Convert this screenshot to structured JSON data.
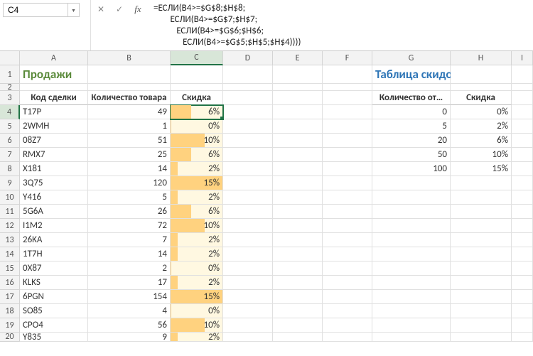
{
  "formula_bar": {
    "name_box": "C4",
    "cancel": "✕",
    "confirm": "✓",
    "fx": "fx",
    "formula": "=ЕСЛИ(B4>=$G$8;$H$8;\n        ЕСЛИ(B4>=$G$7;$H$7;\n           ЕСЛИ(B4>=$G$6;$H$6;\n              ЕСЛИ(B4>=$G$5;$H$5;$H$4))))"
  },
  "columns": [
    "A",
    "B",
    "C",
    "D",
    "E",
    "F",
    "G",
    "H",
    "I"
  ],
  "titles": {
    "sales": "Продажи",
    "discounts": "Таблица скидок"
  },
  "headers": {
    "deal": "Код сделки",
    "qty": "Количество товара",
    "disc": "Скидка",
    "qty_from": "Количество от…",
    "disc2": "Скидка"
  },
  "sales": [
    {
      "code": "T17P",
      "qty": "49",
      "disc": "6%",
      "bar": 40
    },
    {
      "code": "2WMH",
      "qty": "1",
      "disc": "0%",
      "bar": 2
    },
    {
      "code": "08Z7",
      "qty": "51",
      "disc": "10%",
      "bar": 66
    },
    {
      "code": "RMX7",
      "qty": "25",
      "disc": "6%",
      "bar": 40
    },
    {
      "code": "X181",
      "qty": "14",
      "disc": "2%",
      "bar": 14
    },
    {
      "code": "3Q75",
      "qty": "120",
      "disc": "15%",
      "bar": 100
    },
    {
      "code": "Y416",
      "qty": "5",
      "disc": "2%",
      "bar": 14
    },
    {
      "code": "5G6A",
      "qty": "26",
      "disc": "6%",
      "bar": 40
    },
    {
      "code": "I1M2",
      "qty": "72",
      "disc": "10%",
      "bar": 66
    },
    {
      "code": "26KA",
      "qty": "7",
      "disc": "2%",
      "bar": 14
    },
    {
      "code": "1T7H",
      "qty": "14",
      "disc": "2%",
      "bar": 14
    },
    {
      "code": "0X87",
      "qty": "2",
      "disc": "0%",
      "bar": 2
    },
    {
      "code": "KLKS",
      "qty": "17",
      "disc": "2%",
      "bar": 14
    },
    {
      "code": "6PGN",
      "qty": "154",
      "disc": "15%",
      "bar": 100
    },
    {
      "code": "SO85",
      "qty": "4",
      "disc": "0%",
      "bar": 2
    },
    {
      "code": "CPO4",
      "qty": "56",
      "disc": "10%",
      "bar": 66
    },
    {
      "code": "Y835",
      "qty": "9",
      "disc": "2%",
      "bar": 14
    }
  ],
  "discount_table": [
    {
      "from": "0",
      "disc": "0%"
    },
    {
      "from": "5",
      "disc": "2%"
    },
    {
      "from": "20",
      "disc": "6%"
    },
    {
      "from": "50",
      "disc": "10%"
    },
    {
      "from": "100",
      "disc": "15%"
    }
  ],
  "chart_data": {
    "type": "table",
    "title": "Продажи / Таблица скидок",
    "sales_columns": [
      "Код сделки",
      "Количество товара",
      "Скидка"
    ],
    "sales_rows": [
      [
        "T17P",
        49,
        "6%"
      ],
      [
        "2WMH",
        1,
        "0%"
      ],
      [
        "08Z7",
        51,
        "10%"
      ],
      [
        "RMX7",
        25,
        "6%"
      ],
      [
        "X181",
        14,
        "2%"
      ],
      [
        "3Q75",
        120,
        "15%"
      ],
      [
        "Y416",
        5,
        "2%"
      ],
      [
        "5G6A",
        26,
        "6%"
      ],
      [
        "I1M2",
        72,
        "10%"
      ],
      [
        "26KA",
        7,
        "2%"
      ],
      [
        "1T7H",
        14,
        "2%"
      ],
      [
        "0X87",
        2,
        "0%"
      ],
      [
        "KLKS",
        17,
        "2%"
      ],
      [
        "6PGN",
        154,
        "15%"
      ],
      [
        "SO85",
        4,
        "0%"
      ],
      [
        "CPO4",
        56,
        "10%"
      ],
      [
        "Y835",
        9,
        "2%"
      ]
    ],
    "discount_columns": [
      "Количество от…",
      "Скидка"
    ],
    "discount_rows": [
      [
        0,
        "0%"
      ],
      [
        5,
        "2%"
      ],
      [
        20,
        "6%"
      ],
      [
        50,
        "10%"
      ],
      [
        100,
        "15%"
      ]
    ]
  }
}
